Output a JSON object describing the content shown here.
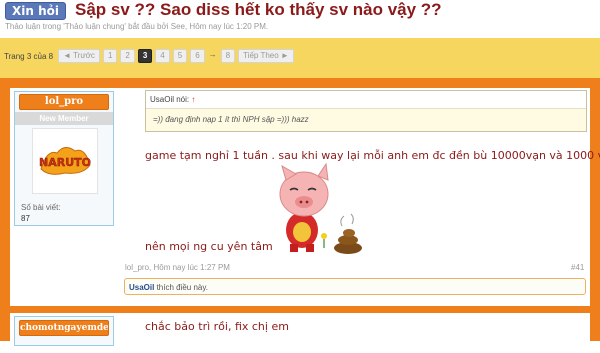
{
  "thread": {
    "prefix": "Xin hỏi",
    "title": "Sập sv ?? Sao diss hết ko thấy sv nào vậy ??",
    "byline": "Thảo luận trong 'Thảo luận chung' bắt đầu bởi See, Hôm nay lúc 1:20 PM."
  },
  "pagination": {
    "label": "Trang 3 của 8",
    "prev": "◄ Trước",
    "pages": [
      "1",
      "2",
      "3",
      "4",
      "5",
      "6"
    ],
    "current": "3",
    "gap": "→",
    "last": "8",
    "next": "Tiếp Theo ►"
  },
  "post1": {
    "username": "lol_pro",
    "usertitle": "New Member",
    "avatar_text": "NARUTO",
    "postcount_label": "Số bài viết:",
    "postcount": "87",
    "quote_author": "UsaOil nói:",
    "quote_arrow": "↑",
    "quote_text": "=)) đang định nạp 1 ít thì NPH sập =))) hazz",
    "message_line1": "game tạm nghỉ 1 tuần . sau khi way lại mỗi anh em đc đền bù 10000vạn và 1000 vàng",
    "message_line2": "nên mọi ng cu yên tâm",
    "meta": "lol_pro, Hôm nay lúc 1:27 PM",
    "number": "#41",
    "likes_user": "UsaOil",
    "likes_suffix": " thích điều này."
  },
  "post2": {
    "username": "chomotngayemden",
    "message": "chắc bảo trì rồi, fix chị em"
  },
  "colors": {
    "frame_orange": "#ef7f1a",
    "nav_yellow": "#f6d65e",
    "title_red": "#8b1a1a",
    "prefix_blue": "#5b78b8"
  }
}
